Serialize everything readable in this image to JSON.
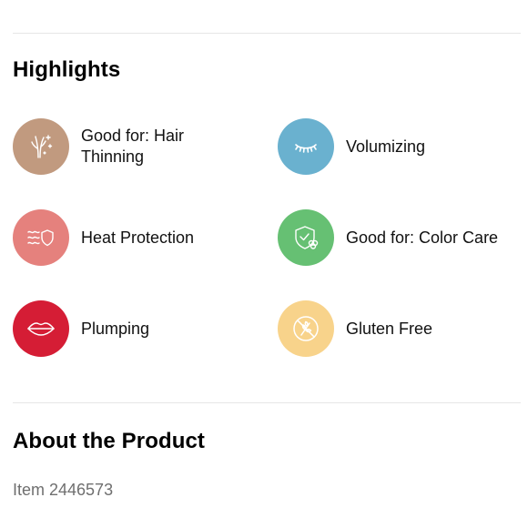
{
  "highlights": {
    "title": "Highlights",
    "items": [
      {
        "label": "Good for: Hair Thinning",
        "icon": "hair-thinning-icon",
        "color": "#c19a7f"
      },
      {
        "label": "Volumizing",
        "icon": "eyelash-icon",
        "color": "#6ab1cf"
      },
      {
        "label": "Heat Protection",
        "icon": "heat-shield-icon",
        "color": "#e5817d"
      },
      {
        "label": "Good for: Color Care",
        "icon": "color-care-shield-icon",
        "color": "#66c073"
      },
      {
        "label": "Plumping",
        "icon": "lips-icon",
        "color": "#d51d35"
      },
      {
        "label": "Gluten Free",
        "icon": "gluten-free-icon",
        "color": "#f8d38b"
      }
    ]
  },
  "about": {
    "title": "About the Product",
    "item_number": "Item 2446573"
  }
}
